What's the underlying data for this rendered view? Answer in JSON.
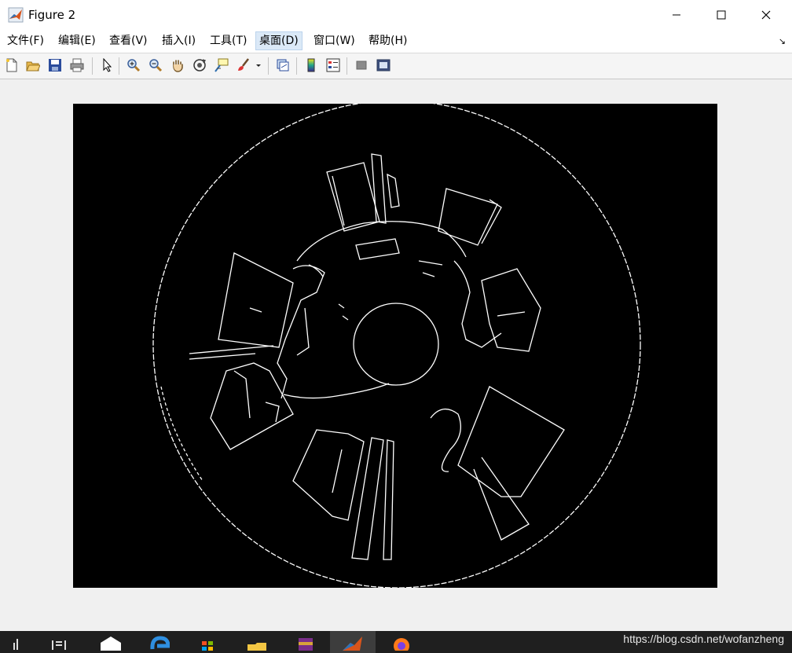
{
  "window": {
    "title": "Figure 2",
    "icon": "matlab-icon"
  },
  "window_controls": [
    "minimize",
    "maximize",
    "close"
  ],
  "menu": {
    "items": [
      {
        "label": "文件(F)"
      },
      {
        "label": "编辑(E)"
      },
      {
        "label": "查看(V)"
      },
      {
        "label": "插入(I)"
      },
      {
        "label": "工具(T)"
      },
      {
        "label": "桌面(D)",
        "active": true
      },
      {
        "label": "窗口(W)"
      },
      {
        "label": "帮助(H)"
      }
    ]
  },
  "toolbar": {
    "buttons": [
      "new-figure-icon",
      "open-file-icon",
      "save-icon",
      "print-icon",
      "pointer-icon",
      "zoom-in-icon",
      "zoom-out-icon",
      "pan-hand-icon",
      "rotate-3d-icon",
      "data-cursor-icon",
      "brush-icon",
      "brush-dropdown-icon",
      "link-plot-icon",
      "insert-colorbar-icon",
      "insert-legend-icon",
      "hide-plot-tools-icon",
      "show-plot-tools-icon"
    ]
  },
  "figure": {
    "content": "binary edge-detection image (white edges on black background)",
    "background": "#000000",
    "edge_color": "#ffffff"
  },
  "taskbar": {
    "apps": [
      "search-icon",
      "task-view-icon",
      "edge-browser-icon",
      "store-icon",
      "file-explorer-icon",
      "winrar-icon",
      "matlab-icon",
      "firefox-icon"
    ],
    "watermark": "https://blog.csdn.net/wofanzheng"
  }
}
